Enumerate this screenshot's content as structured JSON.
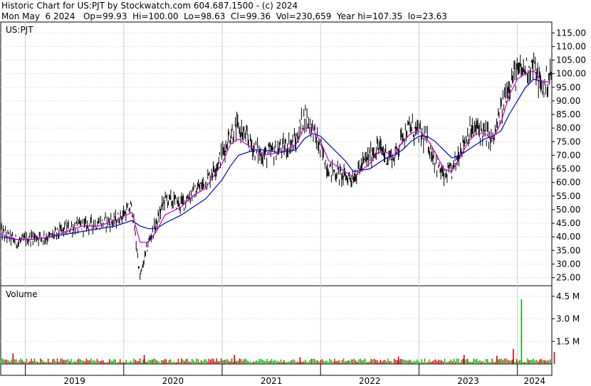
{
  "header": {
    "line1": "Historic Chart for US:PJT by Stockwatch.com 604.687.1500 - (c) 2024",
    "line2": "Mon May  6 2024   Op=99.93  Hi=100.00  Lo=98.63  Cl=99.36  Vol=230,659  Year hi=107.35  lo=23.63"
  },
  "colors": {
    "price": "#000000",
    "ma_short": "#cc00cc",
    "ma_long": "#0000cc",
    "vol_up": "#00aa00",
    "vol_down": "#cc0000",
    "grid": "#cfcfcf"
  },
  "chart_data": [
    {
      "type": "line",
      "title": "US:PJT",
      "ylim": [
        22,
        119
      ],
      "y_ticks": [
        "115.00",
        "110.00",
        "105.00",
        "100.00",
        "95.00",
        "90.00",
        "85.00",
        "80.00",
        "75.00",
        "70.00",
        "65.00",
        "60.00",
        "55.00",
        "50.00",
        "45.00",
        "40.00",
        "35.00",
        "30.00",
        "25.00"
      ],
      "x_ticks": [
        "2019",
        "2020",
        "2021",
        "2022",
        "2023",
        "2024"
      ],
      "grid": true,
      "x_range": [
        "2018-10",
        "2024-05"
      ],
      "series": [
        {
          "values": [
            [
              "2018-10",
              42
            ],
            [
              "2018-12",
              38
            ],
            [
              "2019-02",
              40
            ],
            [
              "2019-04",
              40
            ],
            [
              "2019-06",
              43
            ],
            [
              "2019-08",
              44
            ],
            [
              "2019-10",
              45
            ],
            [
              "2019-12",
              46
            ],
            [
              "2020-02",
              51
            ],
            [
              "2020-03",
              25
            ],
            [
              "2020-04",
              38
            ],
            [
              "2020-05",
              45
            ],
            [
              "2020-06",
              54
            ],
            [
              "2020-08",
              52
            ],
            [
              "2020-09",
              55
            ],
            [
              "2020-11",
              60
            ],
            [
              "2021-01",
              70
            ],
            [
              "2021-02",
              78
            ],
            [
              "2021-03",
              80
            ],
            [
              "2021-05",
              72
            ],
            [
              "2021-06",
              70
            ],
            [
              "2021-08",
              72
            ],
            [
              "2021-10",
              75
            ],
            [
              "2021-11",
              85
            ],
            [
              "2021-12",
              80
            ],
            [
              "2022-01",
              72
            ],
            [
              "2022-02",
              65
            ],
            [
              "2022-04",
              62
            ],
            [
              "2022-05",
              62
            ],
            [
              "2022-07",
              70
            ],
            [
              "2022-08",
              73
            ],
            [
              "2022-09",
              70
            ],
            [
              "2022-10",
              69
            ],
            [
              "2022-11",
              78
            ],
            [
              "2022-12",
              80
            ],
            [
              "2023-01",
              78
            ],
            [
              "2023-02",
              75
            ],
            [
              "2023-03",
              68
            ],
            [
              "2023-04",
              62
            ],
            [
              "2023-05",
              64
            ],
            [
              "2023-06",
              72
            ],
            [
              "2023-07",
              78
            ],
            [
              "2023-08",
              80
            ],
            [
              "2023-09",
              78
            ],
            [
              "2023-10",
              75
            ],
            [
              "2023-11",
              86
            ],
            [
              "2023-12",
              97
            ],
            [
              "2024-01",
              100
            ],
            [
              "2024-02",
              102
            ],
            [
              "2024-03",
              103
            ],
            [
              "2024-04",
              94
            ],
            [
              "2024-05",
              99.36
            ]
          ]
        },
        {
          "values": [
            [
              "2018-10",
              41
            ],
            [
              "2018-12",
              39
            ],
            [
              "2019-02",
              39
            ],
            [
              "2019-04",
              40
            ],
            [
              "2019-06",
              42
            ],
            [
              "2019-08",
              44
            ],
            [
              "2019-10",
              44
            ],
            [
              "2019-12",
              46
            ],
            [
              "2020-02",
              49
            ],
            [
              "2020-03",
              38
            ],
            [
              "2020-04",
              38
            ],
            [
              "2020-05",
              42
            ],
            [
              "2020-06",
              48
            ],
            [
              "2020-08",
              51
            ],
            [
              "2020-09",
              54
            ],
            [
              "2020-11",
              58
            ],
            [
              "2021-01",
              67
            ],
            [
              "2021-02",
              74
            ],
            [
              "2021-03",
              76
            ],
            [
              "2021-05",
              72
            ],
            [
              "2021-06",
              70
            ],
            [
              "2021-08",
              71
            ],
            [
              "2021-10",
              74
            ],
            [
              "2021-11",
              80
            ],
            [
              "2021-12",
              80
            ],
            [
              "2022-01",
              75
            ],
            [
              "2022-02",
              68
            ],
            [
              "2022-04",
              64
            ],
            [
              "2022-05",
              62
            ],
            [
              "2022-07",
              67
            ],
            [
              "2022-08",
              71
            ],
            [
              "2022-09",
              71
            ],
            [
              "2022-10",
              70
            ],
            [
              "2022-11",
              75
            ],
            [
              "2022-12",
              78
            ],
            [
              "2023-01",
              79
            ],
            [
              "2023-02",
              76
            ],
            [
              "2023-03",
              71
            ],
            [
              "2023-04",
              65
            ],
            [
              "2023-05",
              64
            ],
            [
              "2023-06",
              69
            ],
            [
              "2023-07",
              75
            ],
            [
              "2023-08",
              78
            ],
            [
              "2023-09",
              78
            ],
            [
              "2023-10",
              76
            ],
            [
              "2023-11",
              82
            ],
            [
              "2023-12",
              92
            ],
            [
              "2024-01",
              98
            ],
            [
              "2024-02",
              100
            ],
            [
              "2024-03",
              101
            ],
            [
              "2024-04",
              97
            ],
            [
              "2024-05",
              97
            ]
          ]
        },
        {
          "values": [
            [
              "2018-10",
              40
            ],
            [
              "2018-12",
              39
            ],
            [
              "2019-02",
              39
            ],
            [
              "2019-04",
              40
            ],
            [
              "2019-06",
              41
            ],
            [
              "2019-08",
              42
            ],
            [
              "2019-10",
              43
            ],
            [
              "2019-12",
              44
            ],
            [
              "2020-02",
              46
            ],
            [
              "2020-03",
              44
            ],
            [
              "2020-04",
              43
            ],
            [
              "2020-05",
              43
            ],
            [
              "2020-06",
              45
            ],
            [
              "2020-08",
              48
            ],
            [
              "2020-09",
              50
            ],
            [
              "2020-11",
              54
            ],
            [
              "2021-01",
              61
            ],
            [
              "2021-02",
              66
            ],
            [
              "2021-03",
              70
            ],
            [
              "2021-05",
              72
            ],
            [
              "2021-06",
              72
            ],
            [
              "2021-08",
              71
            ],
            [
              "2021-10",
              72
            ],
            [
              "2021-11",
              76
            ],
            [
              "2021-12",
              78
            ],
            [
              "2022-01",
              77
            ],
            [
              "2022-02",
              74
            ],
            [
              "2022-04",
              68
            ],
            [
              "2022-05",
              64
            ],
            [
              "2022-07",
              65
            ],
            [
              "2022-08",
              67
            ],
            [
              "2022-09",
              69
            ],
            [
              "2022-10",
              70
            ],
            [
              "2022-11",
              72
            ],
            [
              "2022-12",
              75
            ],
            [
              "2023-01",
              77
            ],
            [
              "2023-02",
              77
            ],
            [
              "2023-03",
              75
            ],
            [
              "2023-04",
              72
            ],
            [
              "2023-05",
              69
            ],
            [
              "2023-06",
              70
            ],
            [
              "2023-07",
              72
            ],
            [
              "2023-08",
              74
            ],
            [
              "2023-09",
              76
            ],
            [
              "2023-10",
              77
            ],
            [
              "2023-11",
              79
            ],
            [
              "2023-12",
              85
            ],
            [
              "2024-01",
              90
            ],
            [
              "2024-02",
              95
            ],
            [
              "2024-03",
              98
            ],
            [
              "2024-04",
              97
            ],
            [
              "2024-05",
              97
            ]
          ]
        }
      ]
    },
    {
      "type": "bar",
      "title": "Volume",
      "ylim": [
        0,
        5.2
      ],
      "y_ticks": [
        "4.5 M",
        "3.0 M",
        "1.5 M"
      ],
      "spikes": [
        {
          "date": "2018-11",
          "value": 0.7
        },
        {
          "date": "2020-03",
          "value": 0.6
        },
        {
          "date": "2021-02",
          "value": 0.6
        },
        {
          "date": "2021-10",
          "value": 0.45
        },
        {
          "date": "2022-10",
          "value": 0.5
        },
        {
          "date": "2023-06",
          "value": 0.6
        },
        {
          "date": "2023-10",
          "value": 0.55
        },
        {
          "date": "2023-12",
          "value": 1.0
        },
        {
          "date": "2024-01",
          "value": 4.3
        },
        {
          "date": "2024-05",
          "value": 0.8
        }
      ],
      "baseline_volume": 0.22
    }
  ]
}
